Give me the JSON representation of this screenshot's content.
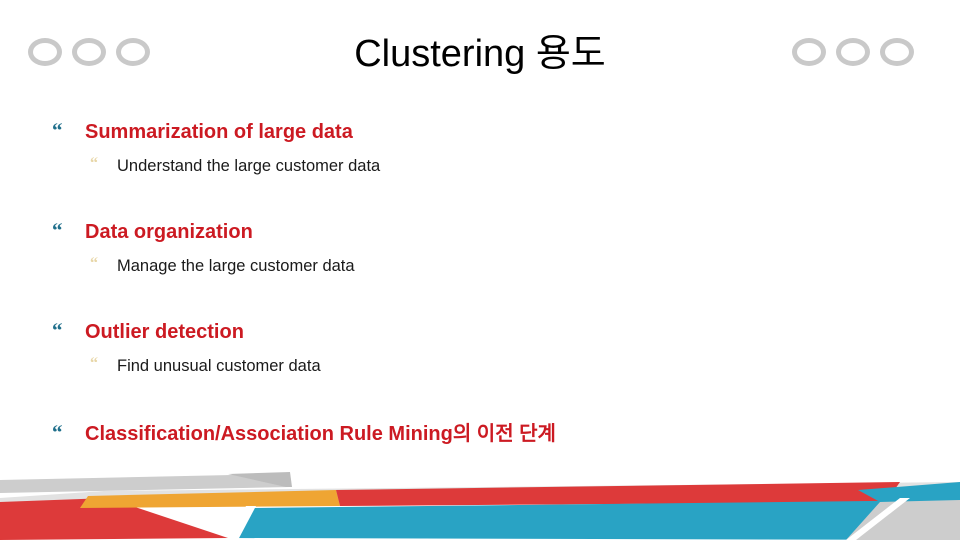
{
  "slide": {
    "title": "Clustering 용도",
    "bullet_marker": "“",
    "sub_bullet_marker": "“",
    "colors": {
      "heading_red": "#cc1a22",
      "bullet_blue": "#1f6f8b",
      "sub_bullet_tan": "#e8d7a8",
      "ring_gray": "#c9c9c9",
      "band_cyan": "#29a3c4",
      "band_red": "#dd3a3a",
      "band_orange": "#efa533",
      "band_gray": "#cdcdcd",
      "band_light_gray": "#e2e2e2",
      "background": "#ffffff"
    },
    "decor": {
      "ring_count_left": 3,
      "ring_count_right": 3
    },
    "groups": [
      {
        "heading": "Summarization of large data",
        "sub": "Understand the large customer data"
      },
      {
        "heading": "Data organization",
        "sub": "Manage the large customer data"
      },
      {
        "heading": "Outlier detection",
        "sub": "Find unusual customer data"
      },
      {
        "heading": "Classification/Association Rule Mining의 이전 단계",
        "sub": ""
      }
    ]
  }
}
